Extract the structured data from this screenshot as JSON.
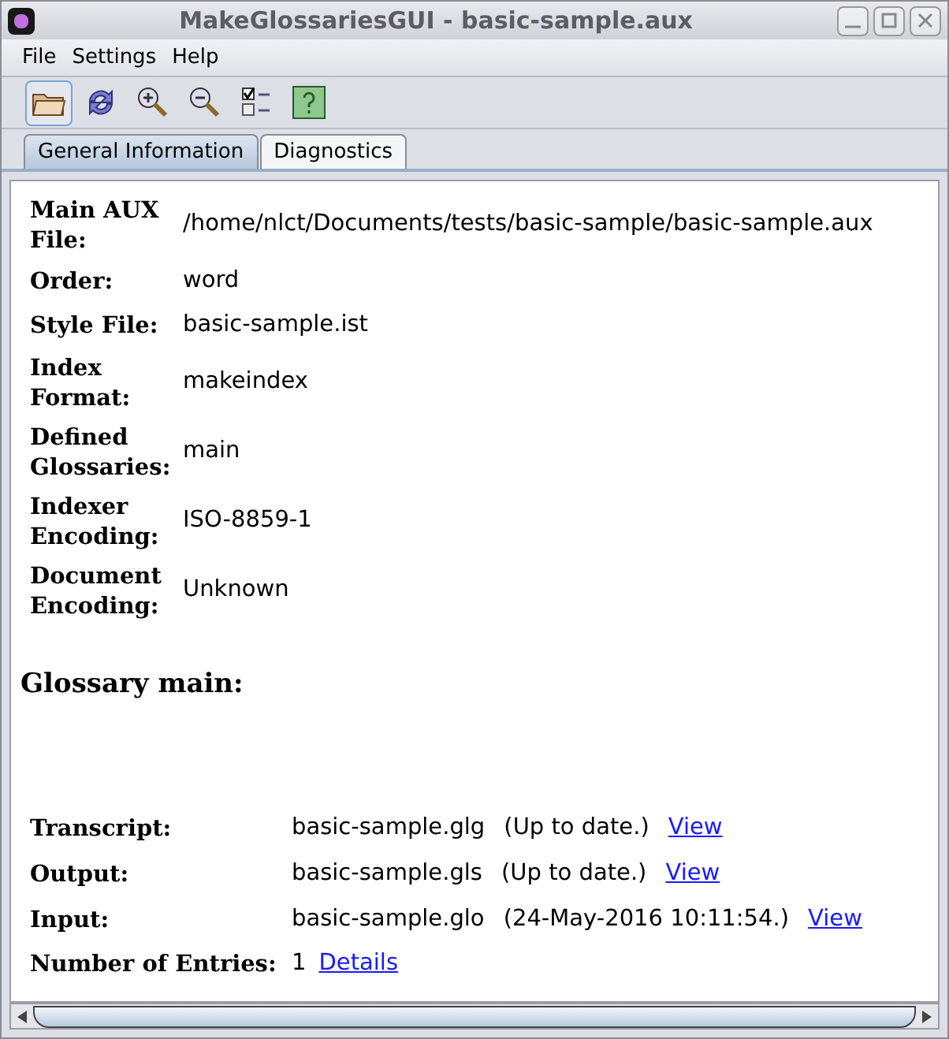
{
  "window": {
    "title": "MakeGlossariesGUI - basic-sample.aux"
  },
  "menu": [
    "File",
    "Settings",
    "Help"
  ],
  "toolbar": [
    {
      "kind": "open",
      "selected": true
    },
    {
      "kind": "reload",
      "selected": false
    },
    {
      "kind": "zoom-in",
      "selected": false
    },
    {
      "kind": "zoom-out",
      "selected": false
    },
    {
      "kind": "checklist",
      "selected": false
    },
    {
      "kind": "help",
      "selected": false
    }
  ],
  "tabs": [
    {
      "label": "General Information",
      "selected": true
    },
    {
      "label": "Diagnostics",
      "selected": false
    }
  ],
  "info": [
    {
      "label": "Main AUX File:",
      "value": "/home/nlct/Documents/tests/basic-sample/basic-sample.aux"
    },
    {
      "label": "Order:",
      "value": "word"
    },
    {
      "label": "Style File:",
      "value": "basic-sample.ist"
    },
    {
      "label": "Index Format:",
      "value": "makeindex"
    },
    {
      "label": "Defined Glossaries:",
      "value": "main"
    },
    {
      "label": "Indexer Encoding:",
      "value": "ISO-8859-1"
    },
    {
      "label": "Document Encoding:",
      "value": "Unknown"
    }
  ],
  "glossary": {
    "heading": "Glossary main:",
    "files": [
      {
        "label": "Transcript:",
        "file": "basic-sample.glg",
        "status": "(Up to date.)",
        "link": "View"
      },
      {
        "label": "Output:",
        "file": "basic-sample.gls",
        "status": "(Up to date.)",
        "link": "View"
      },
      {
        "label": "Input:",
        "file": "basic-sample.glo",
        "status": "(24-May-2016 10:11:54.)",
        "link": "View"
      }
    ],
    "entries": {
      "label": "Number of Entries:",
      "count": "1",
      "link": "Details"
    }
  }
}
